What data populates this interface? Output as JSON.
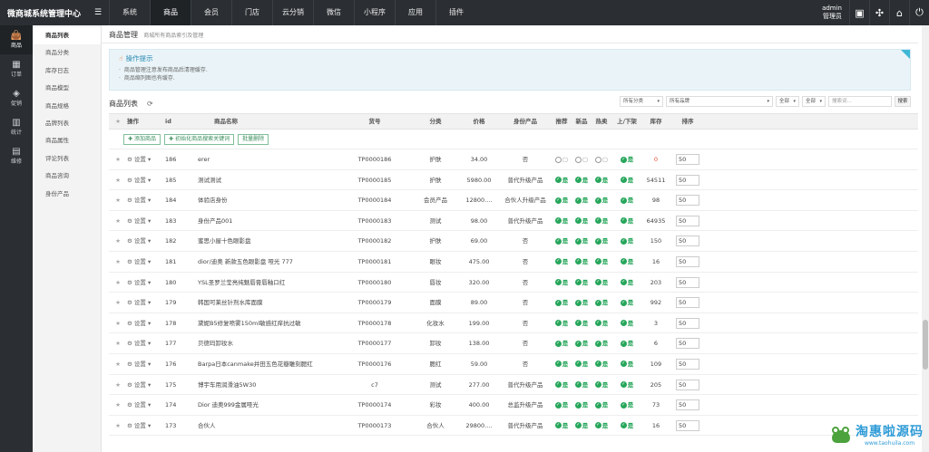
{
  "brand": "微商城系统管理中心",
  "topnav": [
    "系统",
    "商品",
    "会员",
    "门店",
    "云分销",
    "微信",
    "小程序",
    "应用",
    "插件"
  ],
  "topnav_active": 1,
  "user": {
    "name": "admin",
    "role": "管理员"
  },
  "icons": {
    "menu": "hamburger-icon",
    "card": "id-card-icon",
    "network": "network-icon",
    "home": "home-icon",
    "power": "power-icon"
  },
  "left_sidebar": [
    {
      "label": "商品",
      "icon": "bag-icon",
      "active": true
    },
    {
      "label": "订单",
      "icon": "store-icon",
      "active": false
    },
    {
      "label": "促销",
      "icon": "tag-icon",
      "active": false
    },
    {
      "label": "统计",
      "icon": "chart-icon",
      "active": false
    },
    {
      "label": "维修",
      "icon": "wrench-icon",
      "active": false
    }
  ],
  "submenu": [
    "商品列表",
    "商品分类",
    "库存日志",
    "商品模型",
    "商品规格",
    "品牌列表",
    "商品属性",
    "评论列表",
    "商品咨询",
    "身份产品"
  ],
  "submenu_active": 0,
  "page": {
    "title": "商品管理",
    "desc": "商城所有商品索引及管理"
  },
  "tips": {
    "title": "操作提示",
    "items": [
      "商品管理注意发布商品后清理缓存.",
      "商品缩列图也有缓存."
    ]
  },
  "list": {
    "title": "商品列表",
    "filters": {
      "category": "所有分类",
      "brand": "所有品牌",
      "f1": "全部",
      "f2": "全部",
      "search_placeholder": "搜索词...",
      "search_button": "搜索"
    },
    "columns": [
      "操作",
      "id",
      "商品名称",
      "货号",
      "分类",
      "价格",
      "身份产品",
      "推荐",
      "新品",
      "热卖",
      "上/下架",
      "库存",
      "排序"
    ],
    "buttons": {
      "add": "添加商品",
      "init": "初始化商品搜索关键词",
      "batch_delete": "批量删除"
    },
    "setting_label": "设置",
    "yes_label": "是",
    "rows": [
      {
        "id": "186",
        "name": "erer",
        "sku": "TP0000186",
        "category": "护肤",
        "price": "34.00",
        "type": "否",
        "rec": false,
        "new": false,
        "hot": false,
        "shelf": true,
        "stock": "0",
        "sort": "50"
      },
      {
        "id": "185",
        "name": "测试测试",
        "sku": "TP0000185",
        "category": "护肤",
        "price": "5980.00",
        "type": "普代升级产品",
        "rec": true,
        "new": true,
        "hot": true,
        "shelf": true,
        "stock": "54511",
        "sort": "50"
      },
      {
        "id": "184",
        "name": "体验店身份",
        "sku": "TP0000184",
        "category": "会员产品",
        "price": "12800....",
        "type": "合伙人升级产品",
        "rec": true,
        "new": true,
        "hot": true,
        "shelf": true,
        "stock": "98",
        "sort": "50"
      },
      {
        "id": "183",
        "name": "身份产品001",
        "sku": "TP0000183",
        "category": "测试",
        "price": "98.00",
        "type": "普代升级产品",
        "rec": true,
        "new": true,
        "hot": true,
        "shelf": true,
        "stock": "64935",
        "sort": "50"
      },
      {
        "id": "182",
        "name": "蜜思小屋十色眼影盘",
        "sku": "TP0000182",
        "category": "护肤",
        "price": "69.00",
        "type": "否",
        "rec": true,
        "new": true,
        "hot": true,
        "shelf": true,
        "stock": "150",
        "sort": "50"
      },
      {
        "id": "181",
        "name": "dior/迪奥 新款五色眼影盘 哑光 777",
        "sku": "TP0000181",
        "category": "眼妆",
        "price": "475.00",
        "type": "否",
        "rec": true,
        "new": true,
        "hot": true,
        "shelf": true,
        "stock": "16",
        "sort": "50"
      },
      {
        "id": "180",
        "name": "YSL圣罗兰莹亮纯魅唇膏唇釉口红",
        "sku": "TP0000180",
        "category": "唇妆",
        "price": "320.00",
        "type": "否",
        "rec": true,
        "new": true,
        "hot": true,
        "shelf": true,
        "stock": "203",
        "sort": "50"
      },
      {
        "id": "179",
        "name": "韩国可莱丝针剂水库面膜",
        "sku": "TP0000179",
        "category": "面膜",
        "price": "89.00",
        "type": "否",
        "rec": true,
        "new": true,
        "hot": true,
        "shelf": true,
        "stock": "992",
        "sort": "50"
      },
      {
        "id": "178",
        "name": "黛妮B5修复喷雾150ml敏感红痒抗过敏",
        "sku": "TP0000178",
        "category": "化妆水",
        "price": "199.00",
        "type": "否",
        "rec": true,
        "new": true,
        "hot": true,
        "shelf": true,
        "stock": "3",
        "sort": "50"
      },
      {
        "id": "177",
        "name": "贝德玛卸妆水",
        "sku": "TP0000177",
        "category": "卸妆",
        "price": "138.00",
        "type": "否",
        "rec": true,
        "new": true,
        "hot": true,
        "shelf": true,
        "stock": "6",
        "sort": "50"
      },
      {
        "id": "176",
        "name": "Barpa日本canmake井田五色花瓣雕刻腮红",
        "sku": "TP0000176",
        "category": "腮红",
        "price": "59.00",
        "type": "否",
        "rec": true,
        "new": true,
        "hot": true,
        "shelf": true,
        "stock": "109",
        "sort": "50"
      },
      {
        "id": "175",
        "name": "博宇车用润滑油5W30",
        "sku": "c7",
        "category": "测试",
        "price": "277.00",
        "type": "普代升级产品",
        "rec": true,
        "new": true,
        "hot": true,
        "shelf": true,
        "stock": "205",
        "sort": "50"
      },
      {
        "id": "174",
        "name": "Dior 迪奥999金属哑光",
        "sku": "TP0000174",
        "category": "彩妆",
        "price": "400.00",
        "type": "总监升级产品",
        "rec": true,
        "new": true,
        "hot": true,
        "shelf": true,
        "stock": "73",
        "sort": "50"
      },
      {
        "id": "173",
        "name": "合伙人",
        "sku": "TP0000173",
        "category": "合伙人",
        "price": "29800....",
        "type": "普代升级产品",
        "rec": true,
        "new": true,
        "hot": true,
        "shelf": true,
        "stock": "16",
        "sort": "50"
      }
    ]
  },
  "watermark": {
    "title": "淘惠啦源码",
    "url": "www.taohuila.com"
  }
}
